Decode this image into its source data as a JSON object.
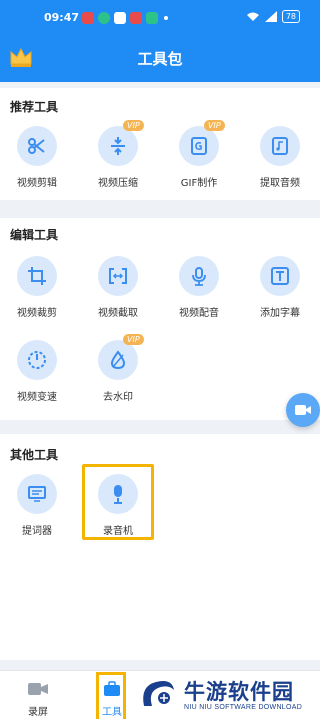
{
  "status_bar": {
    "time": "09:47",
    "battery": "78"
  },
  "header": {
    "title": "工具包"
  },
  "sections": [
    {
      "title": "推荐工具",
      "tools": [
        {
          "label": "视频剪辑",
          "icon": "scissors-icon",
          "vip": ""
        },
        {
          "label": "视频压缩",
          "icon": "compress-icon",
          "vip": "VIP"
        },
        {
          "label": "GIF制作",
          "icon": "gif-icon",
          "vip": "VIP"
        },
        {
          "label": "提取音频",
          "icon": "music-file-icon",
          "vip": ""
        }
      ]
    },
    {
      "title": "编辑工具",
      "tools": [
        {
          "label": "视频裁剪",
          "icon": "crop-icon",
          "vip": ""
        },
        {
          "label": "视频截取",
          "icon": "trim-icon",
          "vip": ""
        },
        {
          "label": "视频配音",
          "icon": "microphone-icon",
          "vip": ""
        },
        {
          "label": "添加字幕",
          "icon": "subtitle-icon",
          "vip": ""
        },
        {
          "label": "视频变速",
          "icon": "speed-icon",
          "vip": ""
        },
        {
          "label": "去水印",
          "icon": "drop-icon",
          "vip": "VIP"
        }
      ]
    },
    {
      "title": "其他工具",
      "tools": [
        {
          "label": "提词器",
          "icon": "teleprompter-icon",
          "vip": ""
        },
        {
          "label": "录音机",
          "icon": "recorder-icon",
          "vip": ""
        }
      ]
    }
  ],
  "bottom_nav": [
    {
      "label": "录屏",
      "icon": "camera-icon"
    },
    {
      "label": "工具",
      "icon": "toolbox-icon"
    }
  ],
  "watermark": {
    "title": "牛游软件园",
    "subtitle": "NIU NIU SOFTWARE DOWNLOAD"
  },
  "colors": {
    "primary": "#1f8bf5",
    "vip": "#f5b453",
    "highlight": "#f5b400",
    "icon_bg": "#d9e9fb"
  }
}
